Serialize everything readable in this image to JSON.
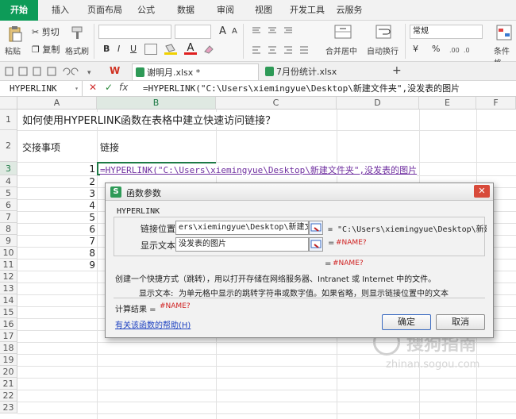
{
  "ribbon_tabs": [
    "开始",
    "插入",
    "页面布局",
    "公式",
    "数据",
    "审阅",
    "视图",
    "开发工具",
    "云服务"
  ],
  "ribbon": {
    "paste": "粘贴",
    "cut": "剪切",
    "copy": "复制",
    "format_painter": "格式刷",
    "bold": "B",
    "italic": "I",
    "underline": "U",
    "font_grow": "A",
    "font_shrink": "A",
    "merge_center": "合并居中",
    "auto_wrap": "自动换行",
    "number_format": "常规",
    "currency": "¥",
    "percent": "%",
    "conditional_format": "条件格"
  },
  "doc_tabs": [
    {
      "name": "谢明月.xlsx *",
      "active": true
    },
    {
      "name": "7月份统计.xlsx",
      "active": false
    }
  ],
  "add_tab": "+",
  "formula_bar": {
    "name_box": "HYPERLINK",
    "cancel": "✕",
    "confirm": "✓",
    "fx": "fx",
    "formula": "=HYPERLINK(\"C:\\Users\\xiemingyue\\Desktop\\新建文件夹\",没发表的图片"
  },
  "columns": [
    "A",
    "B",
    "C",
    "D",
    "E",
    "F"
  ],
  "rows": [
    "1",
    "2",
    "3",
    "4",
    "5",
    "6",
    "7",
    "8",
    "9",
    "10",
    "11",
    "12",
    "13",
    "14",
    "15",
    "16",
    "17",
    "18",
    "19",
    "20",
    "21",
    "22",
    "23"
  ],
  "cells": {
    "a1": "如何使用HYPERLINK函数在表格中建立快速访问链接？",
    "a2": "交接事项",
    "b2": "链接",
    "b3": "=HYPERLINK(\"C:\\Users\\xiemingyue\\Desktop\\新建文件夹\",没发表的图片",
    "numbers": [
      "1",
      "2",
      "3",
      "4",
      "5",
      "6",
      "7",
      "8",
      "9"
    ]
  },
  "dialog": {
    "title": "函数参数",
    "function_name": "HYPERLINK",
    "arg1_label": "链接位置",
    "arg1_value": "ers\\xiemingyue\\Desktop\\新建文件夹\"",
    "arg1_result": "= \"C:\\Users\\xiemingyue\\Desktop\\新建文…",
    "arg2_label": "显示文本",
    "arg2_value": "没发表的图片",
    "arg2_result_eq": "=",
    "arg2_result": "#NAME?",
    "overall_eq": "=",
    "overall_result": "#NAME?",
    "description": "创建一个快捷方式（跳转），用以打开存储在网络服务器、Intranet 或 Internet 中的文件。",
    "param_name": "显示文本:",
    "param_desc": "为单元格中显示的跳转字符串或数字值。如果省略，则显示链接位置中的文本",
    "calc_label": "计算结果 =",
    "calc_result": "#NAME?",
    "help_link": "有关该函数的帮助(H)",
    "ok": "确定",
    "cancel": "取消"
  },
  "watermark": {
    "text": "搜狗指南",
    "sub": "zhinan.sogou.com"
  },
  "colors": {
    "accent": "#0d9b58",
    "error": "#d02020",
    "link": "#1a3fc0",
    "formula_text": "#7030a0"
  }
}
